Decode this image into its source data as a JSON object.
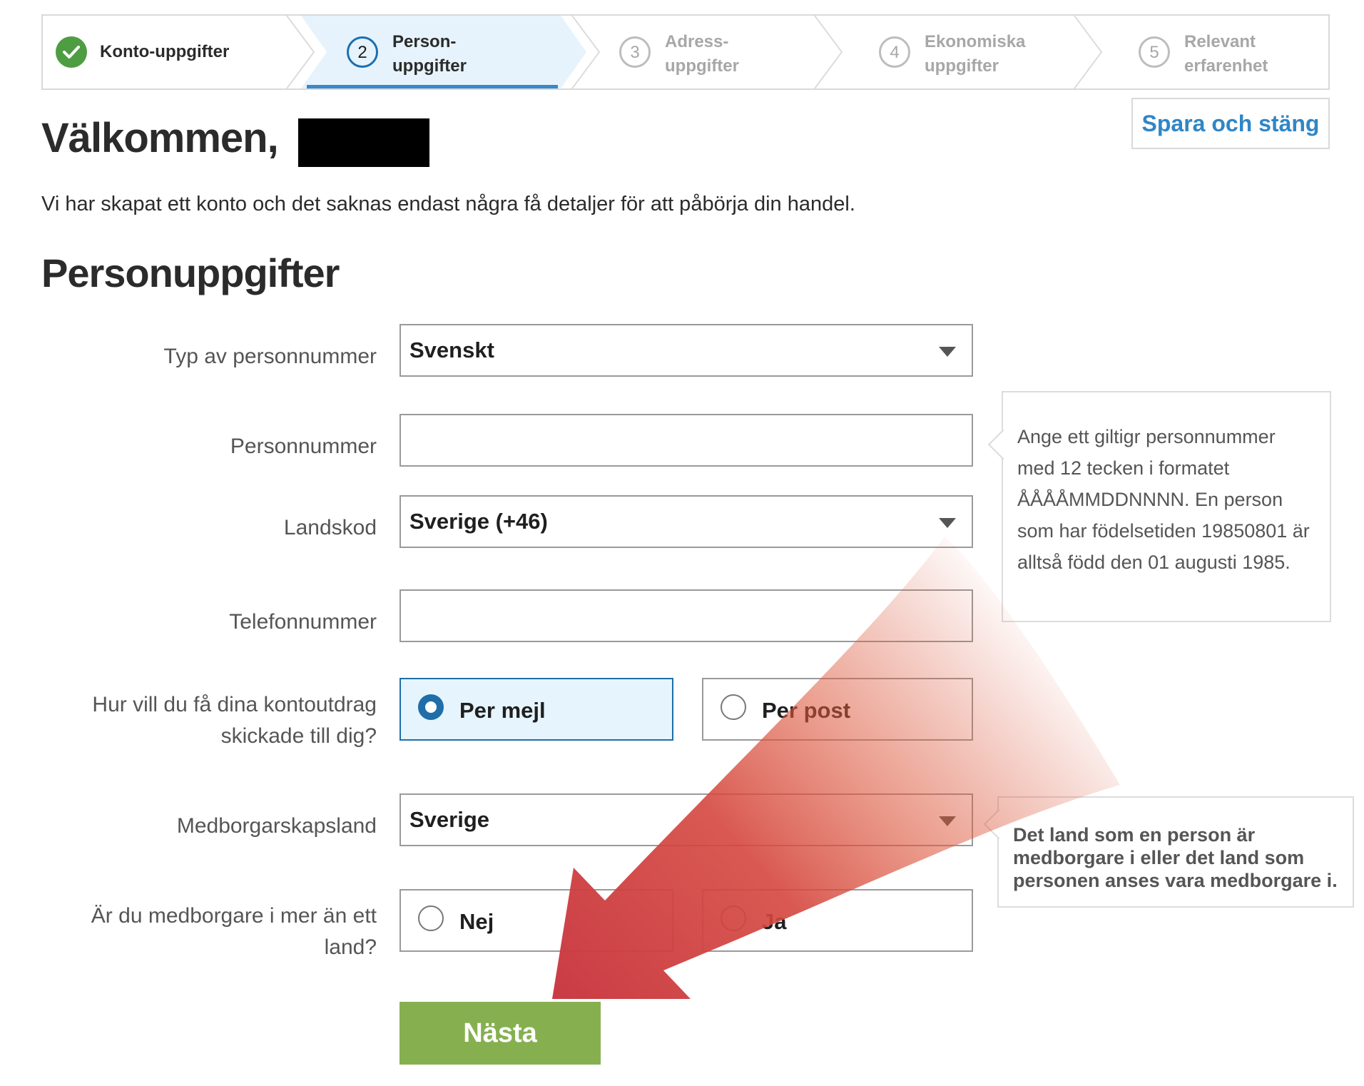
{
  "stepper": {
    "steps": [
      {
        "number": "",
        "label": "Konto-uppgifter",
        "state": "done"
      },
      {
        "number": "2",
        "label": "Person-\nuppgifter",
        "state": "current"
      },
      {
        "number": "3",
        "label": "Adress-\nuppgifter",
        "state": "todo"
      },
      {
        "number": "4",
        "label": "Ekonomiska\nuppgifter",
        "state": "todo"
      },
      {
        "number": "5",
        "label": "Relevant\nerfarenhet",
        "state": "todo"
      }
    ]
  },
  "header": {
    "save_close": "Spara och stäng",
    "welcome": "Välkommen,",
    "intro": "Vi har skapat ett konto och det saknas endast några få detaljer för att påbörja din handel.",
    "section_title": "Personuppgifter"
  },
  "form": {
    "id_type": {
      "label": "Typ av personnummer",
      "value": "Svenskt"
    },
    "personal_number": {
      "label": "Personnummer",
      "value": ""
    },
    "country_code": {
      "label": "Landskod",
      "value": "Sverige (+46)"
    },
    "phone": {
      "label": "Telefonnummer",
      "value": ""
    },
    "statements": {
      "label": "Hur vill du få dina kontoutdrag skickade till dig?",
      "option_email": "Per mejl",
      "option_post": "Per post",
      "selected": "Per mejl"
    },
    "citizenship": {
      "label": "Medborgarskapsland",
      "value": "Sverige"
    },
    "multi_citizenship": {
      "label": "Är du medborgare i mer än ett land?",
      "option_no": "Nej",
      "option_yes": "Ja",
      "selected": ""
    },
    "next_button": "Nästa"
  },
  "tooltips": {
    "personal_number_help": "Ange ett giltigr personnummer med 12 tecken i formatet ÅÅÅÅMMDDNNNN. En person som har födelsetiden 19850801 är alltså född den 01 augusti 1985.",
    "citizenship_help": "Det land som en person är medborgare i eller det land som personen anses vara medborgare i."
  },
  "colors": {
    "accent": "#1f6ea9",
    "done_green": "#4f9d42",
    "next_button": "#86b050",
    "link": "#2f86c6",
    "annotation_arrow": "#cc3a3a"
  }
}
